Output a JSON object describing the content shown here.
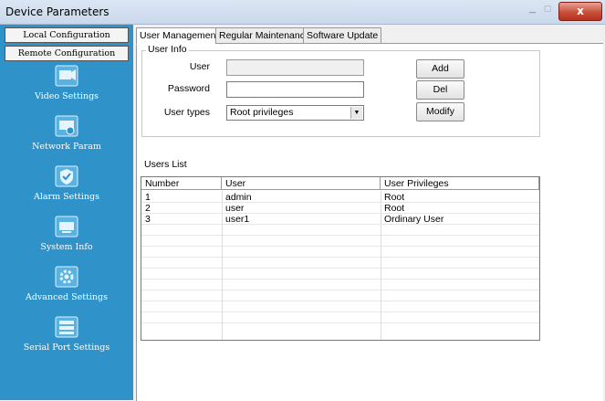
{
  "window": {
    "title": "Device Parameters",
    "close_glyph": "x"
  },
  "sidebar": {
    "local_tab": "Local Configuration",
    "remote_tab": "Remote Configuration",
    "items": [
      {
        "label": "Video Settings",
        "icon": "video-settings-icon"
      },
      {
        "label": "Network Param",
        "icon": "network-icon"
      },
      {
        "label": "Alarm Settings",
        "icon": "alarm-shield-icon"
      },
      {
        "label": "System Info",
        "icon": "system-info-icon"
      },
      {
        "label": "Advanced Settings",
        "icon": "advanced-gear-icon"
      },
      {
        "label": "Serial Port Settings",
        "icon": "serial-port-icon"
      }
    ]
  },
  "tabs": [
    "User Management",
    "Regular Maintenance",
    "Software Update"
  ],
  "user_info": {
    "group_title": "User Info",
    "user_label": "User",
    "user_value": "",
    "password_label": "Password",
    "password_value": "",
    "user_types_label": "User types",
    "user_types_value": "Root privileges",
    "buttons": {
      "add": "Add",
      "del": "Del",
      "modify": "Modify"
    }
  },
  "users_list": {
    "title": "Users List",
    "columns": [
      "Number",
      "User",
      "User Privileges"
    ],
    "rows": [
      {
        "number": "1",
        "user": "admin",
        "privileges": "Root"
      },
      {
        "number": "2",
        "user": "user",
        "privileges": "Root"
      },
      {
        "number": "3",
        "user": "user1",
        "privileges": "Ordinary User"
      }
    ]
  },
  "colors": {
    "sidebar": "#2f92c9",
    "close": "#c7503b"
  }
}
